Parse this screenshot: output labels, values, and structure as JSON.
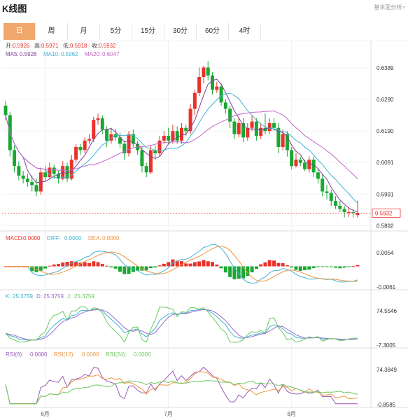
{
  "title": "K线图",
  "tech_link": "基本面分析>",
  "tabs": [
    "日",
    "周",
    "月",
    "5分",
    "15分",
    "30分",
    "60分",
    "4时"
  ],
  "active_tab": 0,
  "colors": {
    "up": "#e8322a",
    "down": "#1aa832",
    "ma5": "#7d3f98",
    "ma10": "#41b3d3",
    "ma20": "#c564c8",
    "diff": "#41b3d3",
    "dea": "#f0943e",
    "k": "#41b3d3",
    "d": "#9a6fd0",
    "j": "#6ac95d",
    "rsi6": "#9b59b6",
    "rsi12": "#f0943e",
    "rsi24": "#6ac95d",
    "accent": "#f0a86c"
  },
  "chart_data": [
    {
      "type": "candlestick",
      "legend_ohlc": [
        {
          "label": "开:",
          "value": "0.5926"
        },
        {
          "label": "高:",
          "value": "0.5971"
        },
        {
          "label": "低:",
          "value": "0.5918"
        },
        {
          "label": "收:",
          "value": "0.5932"
        }
      ],
      "legend_ma": [
        {
          "label": "MA5:",
          "value": "0.5928",
          "color": "#7d3f98"
        },
        {
          "label": "MA10:",
          "value": "0.5962",
          "color": "#41b3d3"
        },
        {
          "label": "MA20:",
          "value": "0.6047",
          "color": "#c564c8"
        }
      ],
      "y_ticks": [
        "0.6389",
        "0.6290",
        "0.6190",
        "0.6091",
        "0.5991",
        "0.5892"
      ],
      "y_range": [
        0.588,
        0.6435
      ],
      "last_price": "0.5932",
      "x_labels": [
        "6月",
        "7月",
        "8月"
      ],
      "x_label_index": [
        9,
        37,
        65
      ],
      "candles": [
        [
          0.627,
          0.624,
          0.6285,
          0.6225
        ],
        [
          0.624,
          0.613,
          0.625,
          0.611
        ],
        [
          0.613,
          0.608,
          0.6145,
          0.606
        ],
        [
          0.608,
          0.605,
          0.6095,
          0.6035
        ],
        [
          0.605,
          0.604,
          0.6065,
          0.6025
        ],
        [
          0.604,
          0.603,
          0.6055,
          0.6015
        ],
        [
          0.603,
          0.602,
          0.605,
          0.6
        ],
        [
          0.602,
          0.6,
          0.604,
          0.5985
        ],
        [
          0.6,
          0.606,
          0.6075,
          0.599
        ],
        [
          0.606,
          0.6045,
          0.608,
          0.603
        ],
        [
          0.6045,
          0.6075,
          0.609,
          0.604
        ],
        [
          0.6075,
          0.6055,
          0.6085,
          0.604
        ],
        [
          0.6055,
          0.604,
          0.6065,
          0.6025
        ],
        [
          0.604,
          0.608,
          0.6095,
          0.6035
        ],
        [
          0.608,
          0.604,
          0.609,
          0.603
        ],
        [
          0.604,
          0.61,
          0.6115,
          0.6035
        ],
        [
          0.61,
          0.614,
          0.615,
          0.609
        ],
        [
          0.614,
          0.613,
          0.615,
          0.6115
        ],
        [
          0.613,
          0.616,
          0.617,
          0.612
        ],
        [
          0.616,
          0.6165,
          0.618,
          0.615
        ],
        [
          0.6165,
          0.6225,
          0.6235,
          0.6155
        ],
        [
          0.6225,
          0.623,
          0.6245,
          0.621
        ],
        [
          0.623,
          0.6195,
          0.624,
          0.618
        ],
        [
          0.6195,
          0.616,
          0.6205,
          0.614
        ],
        [
          0.616,
          0.618,
          0.62,
          0.615
        ],
        [
          0.618,
          0.617,
          0.6195,
          0.616
        ],
        [
          0.617,
          0.615,
          0.6185,
          0.6135
        ],
        [
          0.615,
          0.612,
          0.616,
          0.61
        ],
        [
          0.612,
          0.618,
          0.619,
          0.611
        ],
        [
          0.618,
          0.615,
          0.6195,
          0.614
        ],
        [
          0.615,
          0.613,
          0.616,
          0.6115
        ],
        [
          0.613,
          0.608,
          0.614,
          0.606
        ],
        [
          0.608,
          0.606,
          0.609,
          0.6045
        ],
        [
          0.606,
          0.613,
          0.6145,
          0.6055
        ],
        [
          0.613,
          0.612,
          0.6145,
          0.61
        ],
        [
          0.612,
          0.616,
          0.6175,
          0.611
        ],
        [
          0.616,
          0.6175,
          0.619,
          0.615
        ],
        [
          0.6175,
          0.616,
          0.62,
          0.615
        ],
        [
          0.616,
          0.619,
          0.621,
          0.615
        ],
        [
          0.619,
          0.616,
          0.6205,
          0.615
        ],
        [
          0.616,
          0.62,
          0.6215,
          0.615
        ],
        [
          0.62,
          0.619,
          0.621,
          0.6175
        ],
        [
          0.619,
          0.626,
          0.6275,
          0.618
        ],
        [
          0.626,
          0.631,
          0.632,
          0.624
        ],
        [
          0.631,
          0.636,
          0.639,
          0.63
        ],
        [
          0.636,
          0.639,
          0.6395,
          0.634
        ],
        [
          0.639,
          0.6365,
          0.641,
          0.635
        ],
        [
          0.6365,
          0.632,
          0.6375,
          0.6305
        ],
        [
          0.632,
          0.633,
          0.6345,
          0.631
        ],
        [
          0.633,
          0.628,
          0.634,
          0.627
        ],
        [
          0.628,
          0.626,
          0.629,
          0.6245
        ],
        [
          0.626,
          0.622,
          0.627,
          0.62
        ],
        [
          0.622,
          0.618,
          0.623,
          0.6165
        ],
        [
          0.618,
          0.6215,
          0.623,
          0.617
        ],
        [
          0.6215,
          0.617,
          0.623,
          0.6155
        ],
        [
          0.617,
          0.62,
          0.6215,
          0.616
        ],
        [
          0.62,
          0.622,
          0.624,
          0.619
        ],
        [
          0.622,
          0.6175,
          0.623,
          0.616
        ],
        [
          0.6175,
          0.62,
          0.6215,
          0.6165
        ],
        [
          0.62,
          0.619,
          0.6245,
          0.618
        ],
        [
          0.619,
          0.6215,
          0.623,
          0.618
        ],
        [
          0.6215,
          0.62,
          0.623,
          0.619
        ],
        [
          0.62,
          0.614,
          0.6215,
          0.612
        ],
        [
          0.614,
          0.618,
          0.6195,
          0.613
        ],
        [
          0.618,
          0.613,
          0.619,
          0.611
        ],
        [
          0.613,
          0.608,
          0.614,
          0.607
        ],
        [
          0.608,
          0.61,
          0.612,
          0.6075
        ],
        [
          0.61,
          0.609,
          0.611,
          0.608
        ],
        [
          0.609,
          0.607,
          0.61,
          0.6065
        ],
        [
          0.607,
          0.61,
          0.611,
          0.606
        ],
        [
          0.61,
          0.606,
          0.611,
          0.6045
        ],
        [
          0.606,
          0.604,
          0.607,
          0.6025
        ],
        [
          0.604,
          0.6,
          0.6055,
          0.5985
        ],
        [
          0.6,
          0.5995,
          0.602,
          0.5975
        ],
        [
          0.5995,
          0.597,
          0.6005,
          0.5955
        ],
        [
          0.597,
          0.5955,
          0.5985,
          0.5945
        ],
        [
          0.5955,
          0.5945,
          0.597,
          0.5935
        ],
        [
          0.5945,
          0.5935,
          0.5955,
          0.5918
        ],
        [
          0.5935,
          0.5935,
          0.595,
          0.592
        ],
        [
          0.5935,
          0.5932,
          0.5945,
          0.5918
        ],
        [
          0.5926,
          0.5932,
          0.5971,
          0.5918
        ]
      ]
    },
    {
      "type": "bar",
      "name": "MACD",
      "legend": [
        {
          "label": "MACD:",
          "value": "0.0000",
          "color": "#e8322a"
        },
        {
          "label": "DIFF:",
          "value": "0.0000",
          "color": "#41b3d3"
        },
        {
          "label": "DEA:",
          "value": "0.0000",
          "color": "#f0943e"
        }
      ],
      "y_ticks": [
        "0.0054",
        "-0.0061"
      ]
    },
    {
      "type": "line",
      "name": "KDJ",
      "legend": [
        {
          "label": "K:",
          "value": "25.3759",
          "color": "#41b3d3"
        },
        {
          "label": "D:",
          "value": "25.3759",
          "color": "#9a6fd0"
        },
        {
          "label": "J:",
          "value": "25.3759",
          "color": "#6ac95d"
        }
      ],
      "y_ticks": [
        "74.5546",
        "-7.3005"
      ]
    },
    {
      "type": "line",
      "name": "RSI",
      "legend": [
        {
          "label": "RSI(6):",
          "value": "0.0000",
          "color": "#9b59b6"
        },
        {
          "label": "RSI(12):",
          "value": "0.0000",
          "color": "#f0943e"
        },
        {
          "label": "RSI(24):",
          "value": "0.0000",
          "color": "#6ac95d"
        }
      ],
      "y_ticks": [
        "74.3849",
        "-0.8585"
      ]
    }
  ]
}
